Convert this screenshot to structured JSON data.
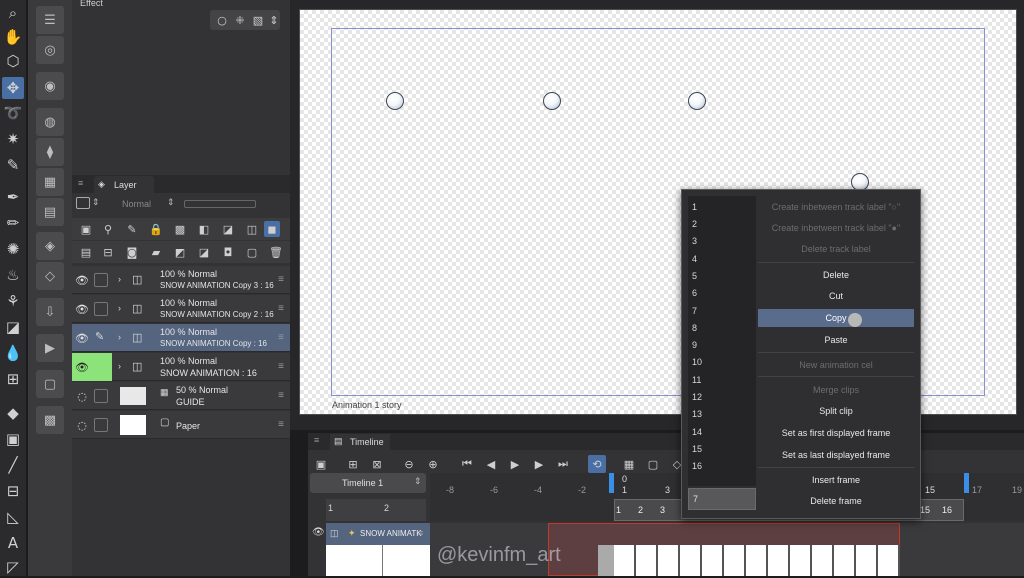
{
  "effect_panel": {
    "title": "Effect"
  },
  "layer_panel": {
    "tab_label": "Layer",
    "blend_mode": "Normal",
    "layers": [
      {
        "opacity_mode": "100 %  Normal",
        "name": "SNOW ANIMATION Copy 3 : 16"
      },
      {
        "opacity_mode": "100 %  Normal",
        "name": "SNOW ANIMATION Copy 2 : 16"
      },
      {
        "opacity_mode": "100 %  Normal",
        "name": "SNOW ANIMATION Copy : 16"
      },
      {
        "opacity_mode": "100 %  Normal",
        "name": "SNOW ANIMATION : 16"
      },
      {
        "opacity_mode": "50 %  Normal",
        "name": "GUIDE"
      },
      {
        "opacity_mode": "",
        "name": "Paper"
      }
    ]
  },
  "canvas": {
    "story_label": "Animation 1 story"
  },
  "timeline": {
    "tab_label": "Timeline",
    "track_name": "Timeline 1",
    "track_start_numbers": [
      "1",
      "2"
    ],
    "ruler_labels": [
      "-8",
      "-6",
      "-4",
      "-2",
      "0",
      "1",
      "3",
      "15",
      "17",
      "19"
    ],
    "frame_cells": [
      "1",
      "2",
      "3",
      "15",
      "16"
    ],
    "layer_track_label": "SNOW ANIMATK"
  },
  "context_menu": {
    "numbers": [
      "1",
      "2",
      "3",
      "4",
      "5",
      "6",
      "7",
      "8",
      "9",
      "10",
      "11",
      "12",
      "13",
      "14",
      "15",
      "16"
    ],
    "input_value": "7",
    "items": [
      {
        "label": "Create inbetween track label \"○\"",
        "disabled": true
      },
      {
        "label": "Create inbetween track label \"●\"",
        "disabled": true
      },
      {
        "label": "Delete track label",
        "disabled": true
      },
      {
        "label": "Delete",
        "disabled": false
      },
      {
        "label": "Cut",
        "disabled": false
      },
      {
        "label": "Copy",
        "disabled": false,
        "highlighted": true
      },
      {
        "label": "Paste",
        "disabled": false
      },
      {
        "label": "New animation cel",
        "disabled": true
      },
      {
        "label": "Merge clips",
        "disabled": true
      },
      {
        "label": "Split clip",
        "disabled": false
      },
      {
        "label": "Set as first displayed frame",
        "disabled": false
      },
      {
        "label": "Set as last displayed frame",
        "disabled": false
      },
      {
        "label": "Insert frame",
        "disabled": false
      },
      {
        "label": "Delete frame",
        "disabled": false
      }
    ]
  },
  "watermark": "@kevinfm_art",
  "colors": {
    "accent": "#4a6fa5",
    "selected_layer": "#55657f",
    "highlight": "#5a6c8c",
    "visible_green": "#8be37a",
    "timeline_marker": "#3a8ee6",
    "red_selection": "#c0392b"
  }
}
